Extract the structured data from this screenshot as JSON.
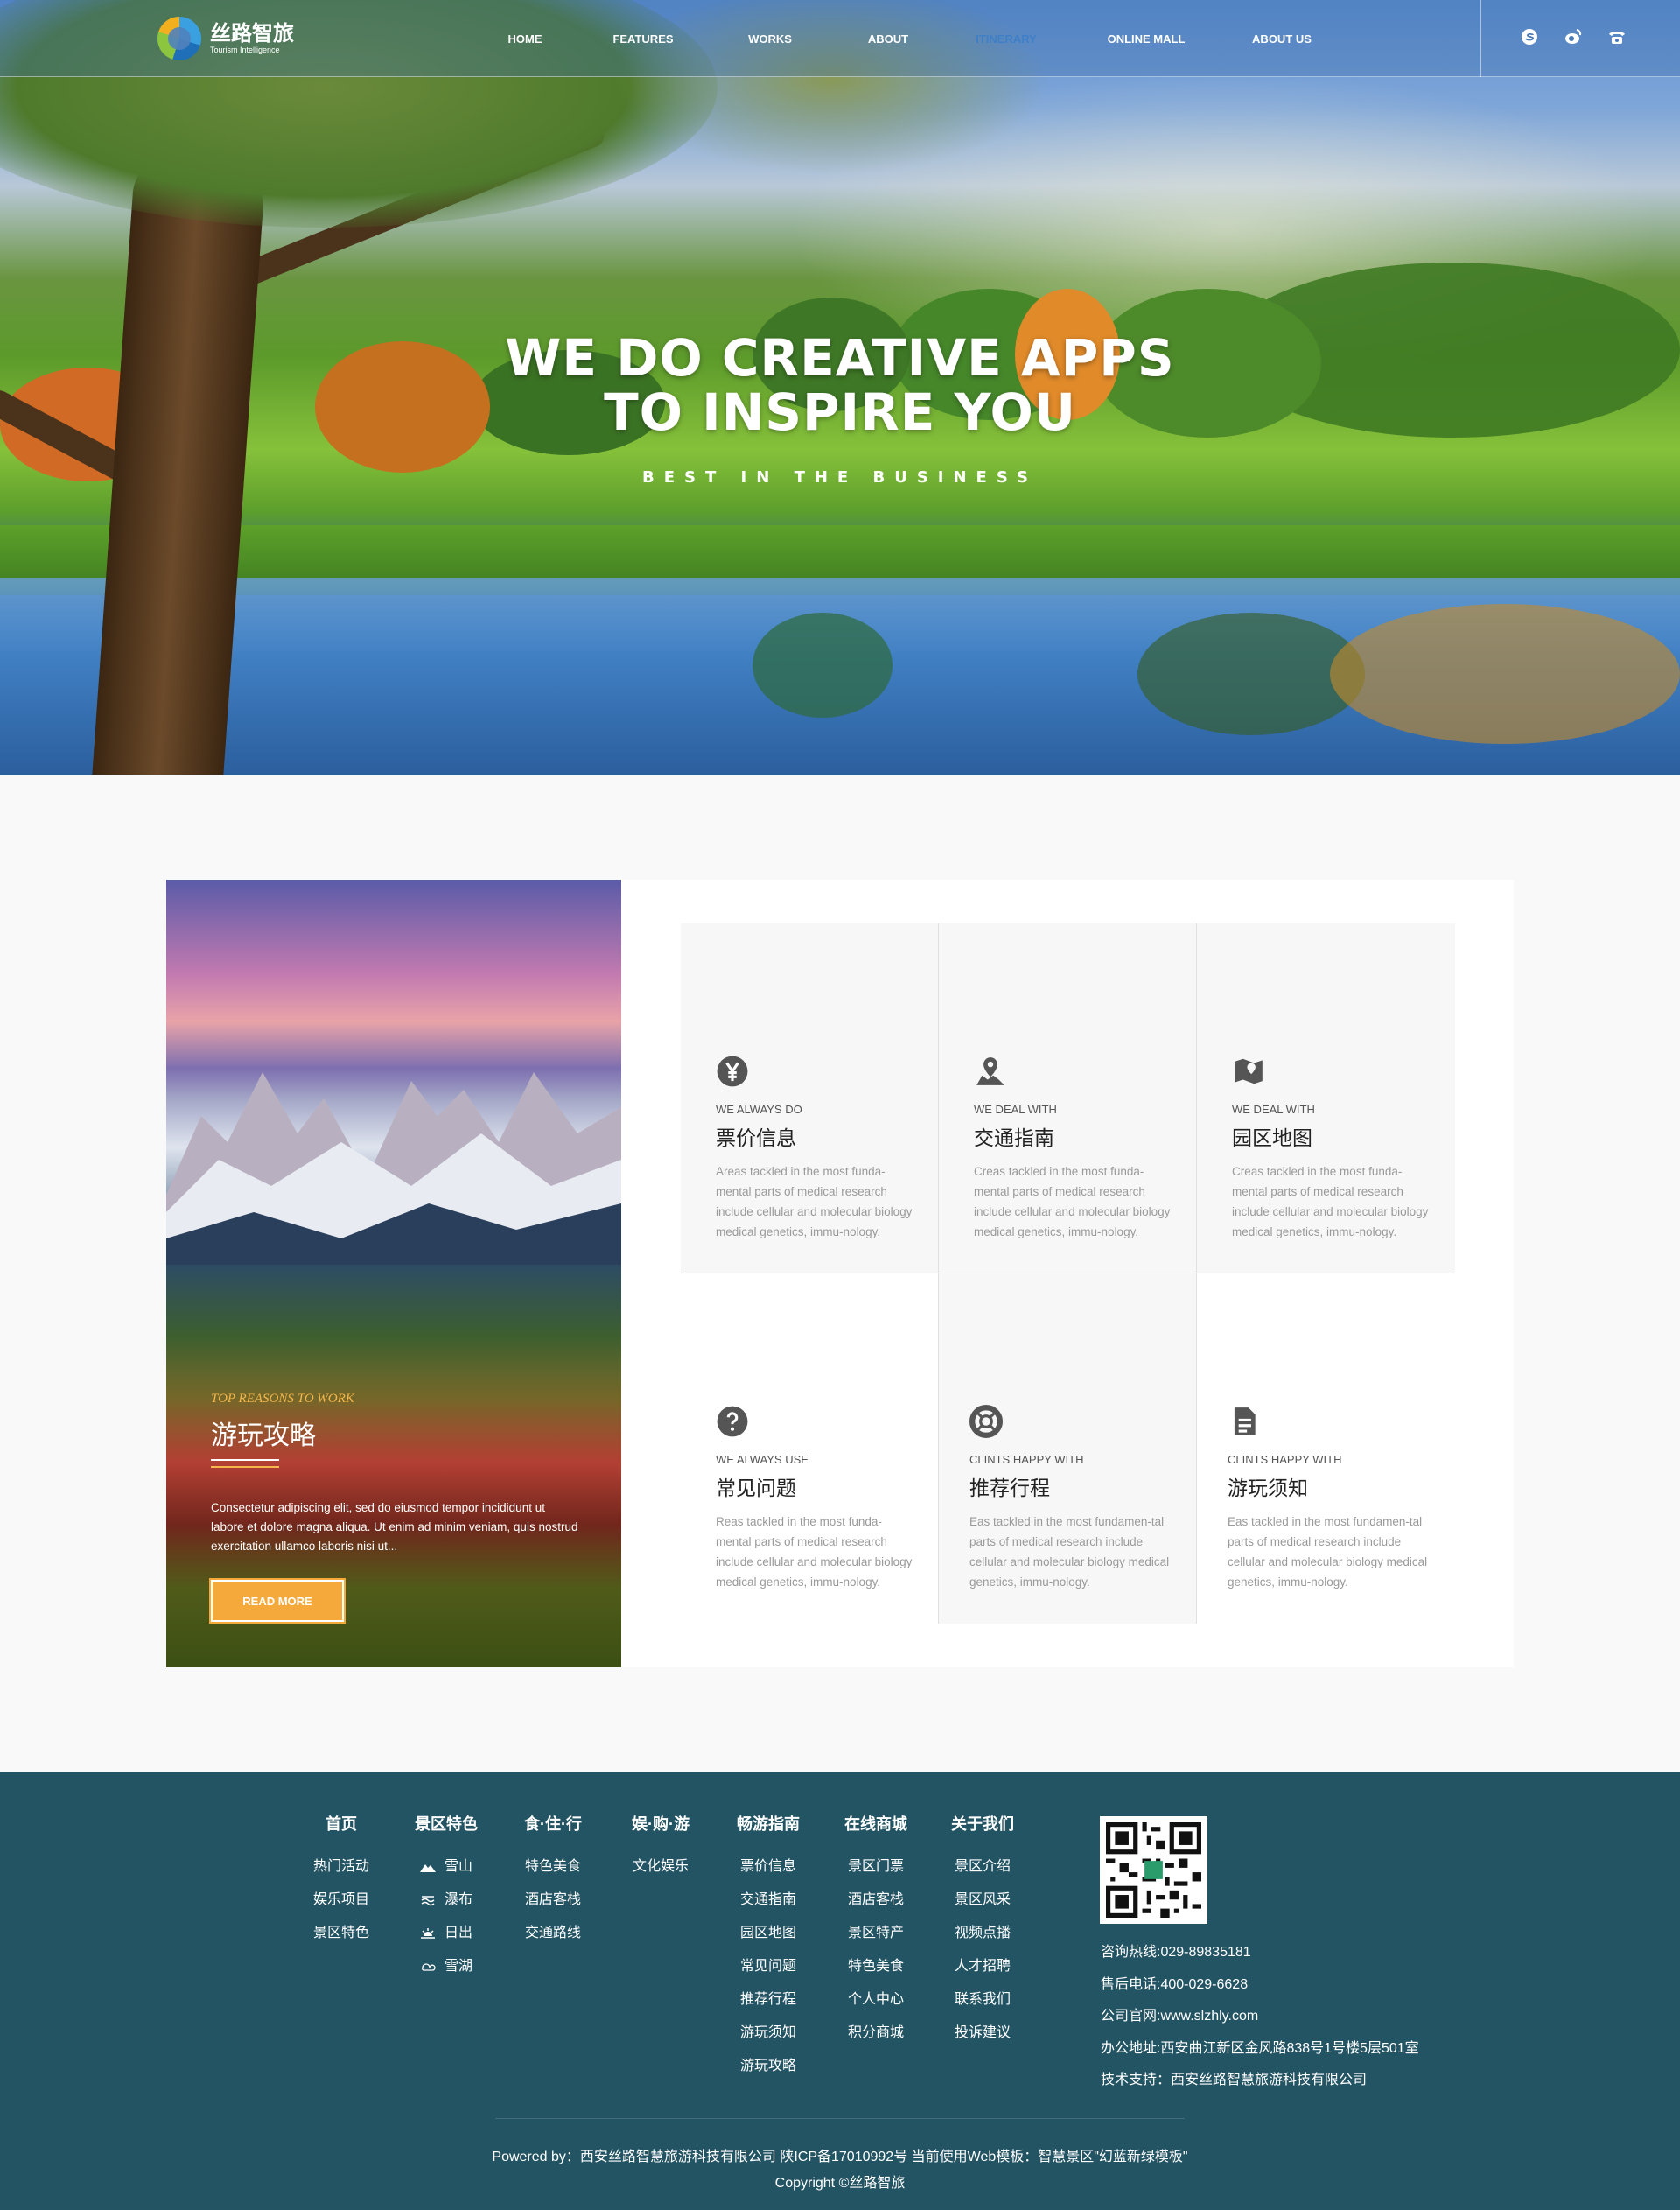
{
  "nav": {
    "logo_cn": "丝路智旅",
    "logo_en": "Tourism Intelligence",
    "items": [
      {
        "label": "HOME",
        "active": false
      },
      {
        "label": "FEATURES",
        "active": false
      },
      {
        "label": "WORKS",
        "active": false
      },
      {
        "label": "ABOUT",
        "active": false
      },
      {
        "label": "ITINERARY",
        "active": true
      },
      {
        "label": "ONLINE MALL",
        "active": false
      },
      {
        "label": "ABOUT US",
        "active": false
      }
    ],
    "icons": [
      "skype-icon",
      "weibo-icon",
      "phone-icon"
    ]
  },
  "hero": {
    "title_line1": "WE DO CREATIVE APPS",
    "title_line2": "TO INSPIRE YOU",
    "subtitle": "BEST IN THE BUSINESS"
  },
  "promo": {
    "kicker": "TOP REASONS TO WORK",
    "title": "游玩攻略",
    "text": "Consectetur adipiscing elit, sed do eiusmod tempor incididunt ut labore et dolore magna aliqua. Ut enim ad minim veniam, quis nostrud exercitation ullamco laboris nisi ut...",
    "button": "READ MORE"
  },
  "features": [
    {
      "icon": "yen-icon",
      "kicker": "WE ALWAYS DO",
      "title": "票价信息",
      "text": "Areas tackled in the most funda-mental parts of medical research include cellular and molecular biology medical genetics, immu-nology."
    },
    {
      "icon": "map-pin-icon",
      "kicker": "WE DEAL WITH",
      "title": "交通指南",
      "text": "Creas tackled in the most funda-mental parts of medical research include cellular and molecular biology medical genetics, immu-nology."
    },
    {
      "icon": "map-icon",
      "kicker": "WE DEAL WITH",
      "title": "园区地图",
      "text": "Creas tackled in the most funda-mental parts of medical research include cellular and molecular biology medical genetics, immu-nology."
    },
    {
      "icon": "question-icon",
      "kicker": "WE ALWAYS USE",
      "title": "常见问题",
      "text": "Reas tackled in the most funda-mental parts of medical research include cellular and molecular biology medical genetics, immu-nology."
    },
    {
      "icon": "lifebuoy-icon",
      "kicker": "CLINTS HAPPY WITH",
      "title": "推荐行程",
      "text": "Eas tackled in the most fundamen-tal parts of medical research include cellular and molecular biology medical genetics, immu-nology."
    },
    {
      "icon": "document-icon",
      "kicker": "CLINTS HAPPY WITH",
      "title": "游玩须知",
      "text": "Eas tackled in the most fundamen-tal parts of medical research include cellular and molecular biology medical genetics, immu-nology."
    }
  ],
  "footer": {
    "columns": [
      {
        "head": "首页",
        "items": [
          "热门活动",
          "娱乐项目",
          "景区特色"
        ]
      },
      {
        "head": "景区特色",
        "items": [
          "雪山",
          "瀑布",
          "日出",
          "雪湖"
        ]
      },
      {
        "head": "食·住·行",
        "items": [
          "特色美食",
          "酒店客栈",
          "交通路线"
        ]
      },
      {
        "head": "娱·购·游",
        "items": [
          "文化娱乐"
        ]
      },
      {
        "head": "畅游指南",
        "items": [
          "票价信息",
          "交通指南",
          "园区地图",
          "常见问题",
          "推荐行程",
          "游玩须知",
          "游玩攻略"
        ]
      },
      {
        "head": "在线商城",
        "items": [
          "景区门票",
          "酒店客栈",
          "景区特产",
          "特色美食",
          "个人中心",
          "积分商城"
        ]
      },
      {
        "head": "关于我们",
        "items": [
          "景区介绍",
          "景区风采",
          "视频点播",
          "人才招聘",
          "联系我们",
          "投诉建议"
        ]
      }
    ],
    "scenic_icons": [
      "mountain-icon",
      "waterfall-icon",
      "sunrise-icon",
      "lake-icon"
    ],
    "contact": [
      "咨询热线:029-89835181",
      "售后电话:400-029-6628",
      "公司官网:www.slzhly.com",
      "办公地址:西安曲江新区金风路838号1号楼5层501室",
      "技术支持：西安丝路智慧旅游科技有限公司"
    ],
    "powered": "Powered by：西安丝路智慧旅游科技有限公司 陕ICP备17010992号 当前使用Web模板：智慧景区\"幻蓝新绿模板\"",
    "copyright": "Copyright ©丝路智旅"
  },
  "colors": {
    "accent": "#f5a93a",
    "footer_bg": "#235464",
    "nav_active": "#3f7fc8"
  }
}
